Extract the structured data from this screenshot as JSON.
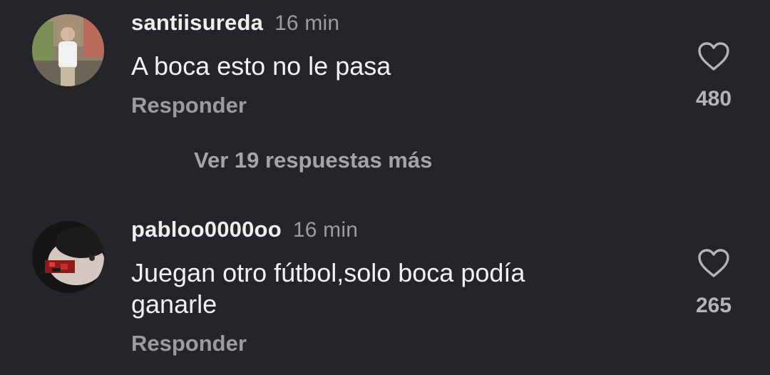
{
  "comments": [
    {
      "username": "santiisureda",
      "time": "16 min",
      "text": "A boca esto no le pasa",
      "reply_label": "Responder",
      "likes": "480"
    },
    {
      "username": "pabloo0000oo",
      "time": "16 min",
      "text": "Juegan otro fútbol,solo boca podía ganarle",
      "reply_label": "Responder",
      "likes": "265"
    }
  ],
  "more_replies_label": "Ver 19 respuestas más",
  "colors": {
    "background": "#242528",
    "primary_text": "#f2f2f4",
    "secondary_text": "#9b9ca1"
  },
  "icons": {
    "like": "heart-outline-icon"
  }
}
